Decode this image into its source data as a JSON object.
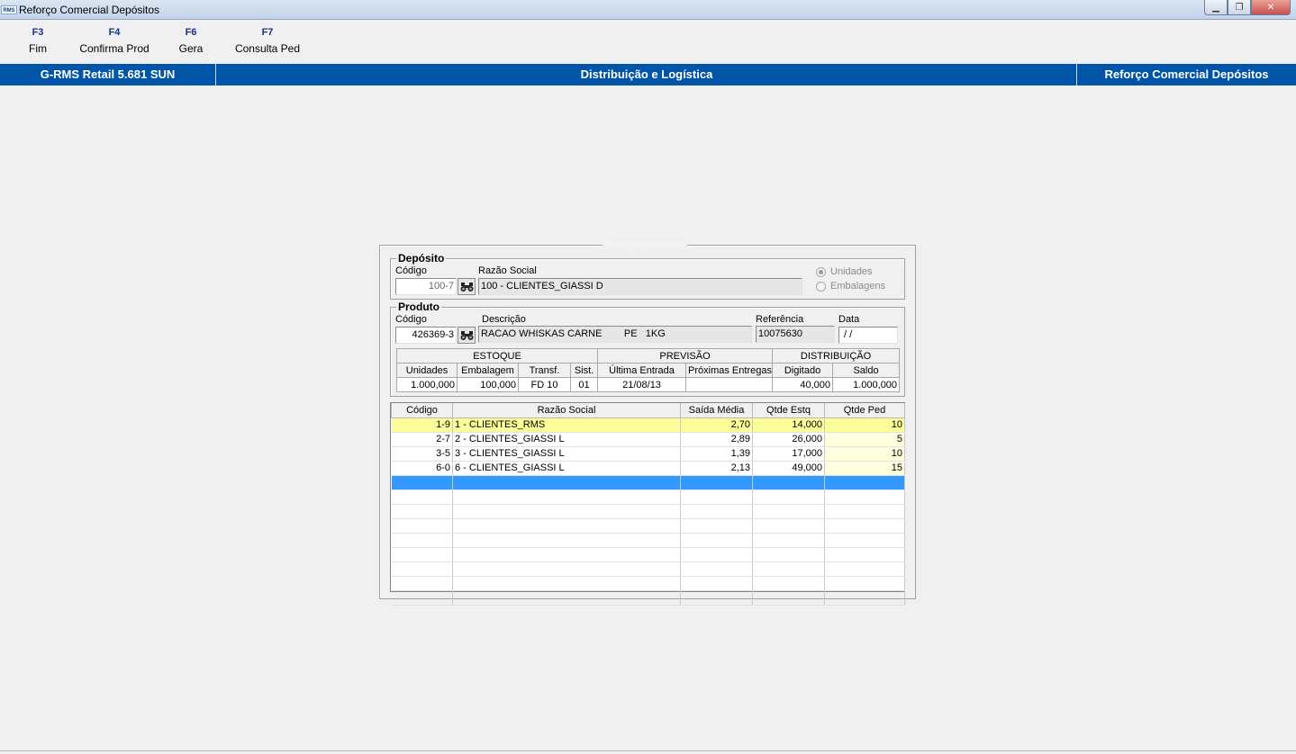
{
  "window": {
    "title": "Reforço Comercial Depósitos",
    "icon_text": "RMS",
    "controls": {
      "minimize": "▁",
      "restore": "❐",
      "close": "✕"
    }
  },
  "function_keys": [
    {
      "key": "F3",
      "label": "Fim"
    },
    {
      "key": "F4",
      "label": "Confirma Prod"
    },
    {
      "key": "F6",
      "label": "Gera"
    },
    {
      "key": "F7",
      "label": "Consulta Ped"
    }
  ],
  "header_band": {
    "left": "G-RMS Retail 5.681 SUN",
    "center": "Distribuição e Logística",
    "right": "Reforço Comercial Depósitos"
  },
  "mode_caption": "Modo Programação",
  "deposito": {
    "title": "Depósito",
    "codigo_label": "Código",
    "codigo_value": "100-7",
    "razao_label": "Razão Social",
    "razao_value": "100 - CLIENTES_GIASSI D",
    "option_unidades": "Unidades",
    "option_embalagens": "Embalagens",
    "selected_option": "Unidades"
  },
  "produto": {
    "title": "Produto",
    "codigo_label": "Código",
    "codigo_value": "426369-3",
    "descricao_label": "Descrição",
    "descricao_value": "RACAO WHISKAS CARNE        PE   1KG",
    "referencia_label": "Referência",
    "referencia_value": "10075630",
    "data_label": "Data",
    "data_value": " / /"
  },
  "stock_table": {
    "groups": [
      "ESTOQUE",
      "PREVISÃO",
      "DISTRIBUIÇÃO"
    ],
    "headers": [
      "Unidades",
      "Embalagem",
      "Transf.",
      "Sist.",
      "Última Entrada",
      "Próximas Entregas",
      "Digitado",
      "Saldo"
    ],
    "values": [
      "1.000,000",
      "100,000",
      "FD 10",
      "01",
      "21/08/13",
      "",
      "40,000",
      "1.000,000"
    ]
  },
  "grid": {
    "headers": [
      "Código",
      "Razão Social",
      "Saída Média",
      "Qtde Estq",
      "Qtde Ped"
    ],
    "rows": [
      [
        "1-9",
        "1 - CLIENTES_RMS",
        "2,70",
        "14,000",
        "10"
      ],
      [
        "2-7",
        "2 - CLIENTES_GIASSI L",
        "2,89",
        "26,000",
        "5"
      ],
      [
        "3-5",
        "3 - CLIENTES_GIASSI L",
        "1,39",
        "17,000",
        "10"
      ],
      [
        "6-0",
        "6 - CLIENTES_GIASSI L",
        "2,13",
        "49,000",
        "15"
      ]
    ]
  },
  "colors": {
    "band": "#0055a8",
    "selected_row": "#ffff99",
    "current_row": "#3399ff",
    "fkey_text": "#1a2f86"
  }
}
